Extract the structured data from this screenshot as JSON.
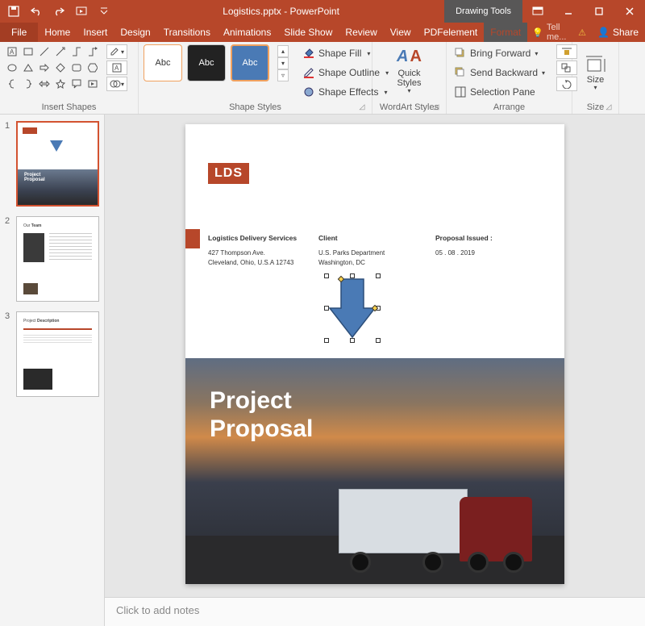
{
  "titlebar": {
    "document_title": "Logistics.pptx - PowerPoint",
    "context_label": "Drawing Tools"
  },
  "tabs": {
    "file": "File",
    "items": [
      "Home",
      "Insert",
      "Design",
      "Transitions",
      "Animations",
      "Slide Show",
      "Review",
      "View",
      "PDFelement"
    ],
    "context_tab": "Format",
    "tell_me": "Tell me...",
    "share": "Share"
  },
  "ribbon": {
    "insert_shapes": {
      "label": "Insert Shapes"
    },
    "shape_styles": {
      "label": "Shape Styles",
      "swatch_text": "Abc",
      "fill": "Shape Fill",
      "outline": "Shape Outline",
      "effects": "Shape Effects"
    },
    "wordart": {
      "label": "WordArt Styles",
      "quick": "Quick Styles"
    },
    "arrange": {
      "label": "Arrange",
      "forward": "Bring Forward",
      "backward": "Send Backward",
      "selection": "Selection Pane"
    },
    "size": {
      "label": "Size",
      "button": "Size"
    }
  },
  "thumbnails": {
    "items": [
      {
        "num": "1",
        "selected": true
      },
      {
        "num": "2",
        "selected": false
      },
      {
        "num": "3",
        "selected": false
      }
    ]
  },
  "slide": {
    "logo": "LDS",
    "col1": {
      "heading": "Logistics Delivery Services",
      "line1": "427 Thompson Ave.",
      "line2": "Cleveland, Ohio, U.S.A 12743"
    },
    "col2": {
      "heading": "Client",
      "line1": "U.S. Parks Department",
      "line2": "Washington, DC"
    },
    "col3": {
      "heading": "Proposal Issued :",
      "line1": "05 . 08 . 2019"
    },
    "hero_title_1": "Project",
    "hero_title_2": "Proposal"
  },
  "notes": {
    "placeholder": "Click to add notes"
  }
}
